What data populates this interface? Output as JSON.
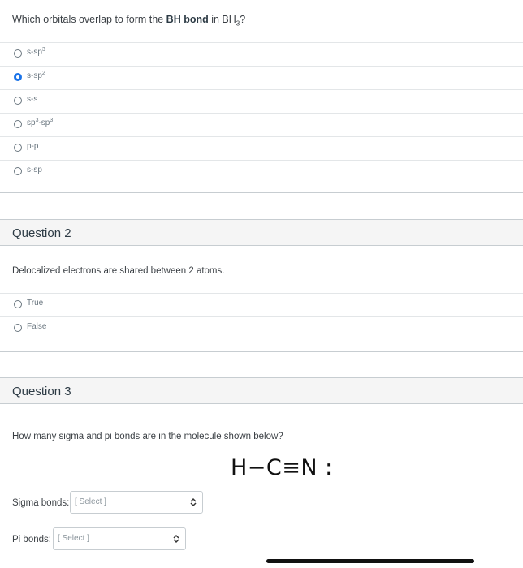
{
  "question1": {
    "text_prefix": "Which orbitals overlap to form the ",
    "text_bold": "BH bond",
    "text_middle": " in BH",
    "text_sub": "3",
    "text_suffix": "?",
    "answers": [
      {
        "base": "s-sp",
        "sup": "3",
        "rest": "",
        "rest_sup": "",
        "selected": false
      },
      {
        "base": "s-sp",
        "sup": "2",
        "rest": "",
        "rest_sup": "",
        "selected": true
      },
      {
        "base": "s-s",
        "sup": "",
        "rest": "",
        "rest_sup": "",
        "selected": false
      },
      {
        "base": "sp",
        "sup": "3",
        "rest": "-sp",
        "rest_sup": "3",
        "selected": false
      },
      {
        "base": "p-p",
        "sup": "",
        "rest": "",
        "rest_sup": "",
        "selected": false
      },
      {
        "base": "s-sp",
        "sup": "",
        "rest": "",
        "rest_sup": "",
        "selected": false
      }
    ]
  },
  "question2": {
    "header": "Question 2",
    "text": "Delocalized electrons are shared between 2 atoms.",
    "answers": [
      {
        "label": "True",
        "selected": false
      },
      {
        "label": "False",
        "selected": false
      }
    ]
  },
  "question3": {
    "header": "Question 3",
    "text": "How many sigma and pi bonds are in the molecule shown below?",
    "molecule": "H−C≡N :",
    "sigma_label": "Sigma bonds:",
    "sigma_select": "[ Select ]",
    "pi_label": "Pi bonds:",
    "pi_select": "[ Select ]"
  },
  "colors": {
    "selected_radio": "#1a73e8",
    "header_bg": "#f5f5f5"
  }
}
